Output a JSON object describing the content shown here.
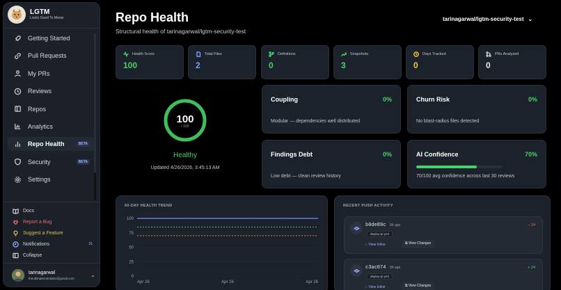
{
  "app": {
    "name": "LGTM",
    "tagline": "Looks Good To Meow"
  },
  "sidebar": {
    "items": [
      {
        "label": "Getting Started",
        "icon": "rocket-icon"
      },
      {
        "label": "Pull Requests",
        "icon": "link-icon"
      },
      {
        "label": "My PRs",
        "icon": "user-icon"
      },
      {
        "label": "Reviews",
        "icon": "history-icon"
      },
      {
        "label": "Repos",
        "icon": "book-icon"
      },
      {
        "label": "Analytics",
        "icon": "chart-icon"
      },
      {
        "label": "Repo Health",
        "icon": "bar-chart-icon",
        "badge": "BETA",
        "active": true
      },
      {
        "label": "Security",
        "icon": "shield-icon",
        "badge": "BETA"
      },
      {
        "label": "Settings",
        "icon": "gear-icon"
      }
    ],
    "bottom": {
      "docs": "Docs",
      "bug": "Report a Bug",
      "feature": "Suggest a Feature",
      "notifications": "Notifications",
      "notifications_count": "31",
      "collapse": "Collapse"
    },
    "user": {
      "name": "tarinagarwal",
      "email": "theultimatemental64@gmail.com"
    }
  },
  "header": {
    "title": "Repo Health",
    "subtitle": "Structural health of tarinagarwal/lgtm-security-test",
    "repo": "tarinagarwal/lgtm-security-test"
  },
  "stats": [
    {
      "label": "Health Score",
      "value": "100",
      "color": "#4ad068",
      "icon": "pulse-icon"
    },
    {
      "label": "Total Files",
      "value": "2",
      "color": "#7f9cff",
      "icon": "file-icon"
    },
    {
      "label": "Definitions",
      "value": "0",
      "color": "#4ad068",
      "icon": "branch-icon"
    },
    {
      "label": "Snapshots",
      "value": "3",
      "color": "#4ad068",
      "icon": "trend-icon"
    },
    {
      "label": "Days Tracked",
      "value": "0",
      "color": "#f0c541",
      "icon": "clock-icon"
    },
    {
      "label": "PRs Analyzed",
      "value": "0",
      "color": "#e6e8ec",
      "icon": "branch-icon"
    }
  ],
  "score": {
    "value": "100",
    "max": "/ 100",
    "status": "Healthy",
    "updated": "Updated 4/26/2026, 3:45:13 AM",
    "fill": 1.0
  },
  "cards": {
    "coupling": {
      "title": "Coupling",
      "pct": "0%",
      "desc": "Modular — dependencies well distributed"
    },
    "churn": {
      "title": "Churn Risk",
      "pct": "0%",
      "desc": "No blast-radius files detected"
    },
    "debt": {
      "title": "Findings Debt",
      "pct": "0%",
      "desc": "Low debt — clean review history"
    },
    "ai": {
      "title": "AI Confidence",
      "pct": "70%",
      "desc": "70/100 avg confidence across last 30 reviews",
      "fill": 0.7
    }
  },
  "trend": {
    "title": "60-DAY HEALTH TREND",
    "chart_data": {
      "type": "line",
      "x": [
        "Apr 26",
        "Apr 26",
        "Apr 26"
      ],
      "y_ticks": [
        "100",
        "75",
        "50",
        "25",
        "0"
      ],
      "ylim": [
        0,
        100
      ],
      "series": [
        {
          "values": [
            100,
            100,
            100
          ],
          "color": "#6f8cff"
        },
        {
          "values": [
            85,
            85,
            85
          ],
          "color": "#4ad068"
        },
        {
          "values": [
            70,
            70,
            70
          ],
          "color": "#f0a030"
        }
      ]
    }
  },
  "push": {
    "title": "RECENT PUSH ACTIVITY",
    "items": [
      {
        "hash": "b0de89c",
        "ago": "9h ago",
        "file": "deploy-pr.yml",
        "diff": "− 24",
        "diff_color": "#ef6b6b",
        "inline": "View Inline",
        "changes": "View Changes"
      },
      {
        "hash": "c3ac074",
        "ago": "9h ago",
        "file": "deploy-pr.yml",
        "diff": "+ 24",
        "diff_color": "#4ad068",
        "inline": "View Inline",
        "changes": "View Changes"
      }
    ]
  }
}
